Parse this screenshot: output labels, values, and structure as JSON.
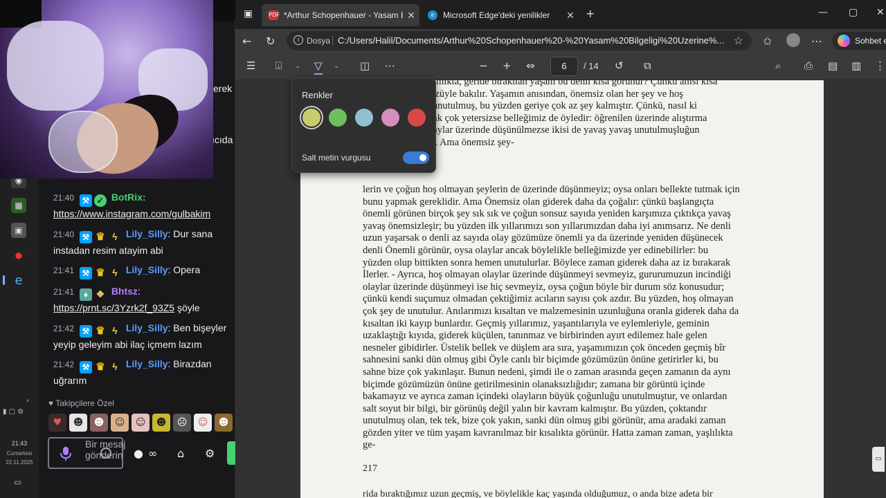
{
  "taskbar": {
    "clock_time": "21:43",
    "clock_day": "Cumartesi",
    "clock_date": "22.11.2025"
  },
  "chat": {
    "partial_text_1": "erek",
    "partial_text_2": "ıcıda",
    "messages": [
      {
        "time": "21:40",
        "user": "BotRix:",
        "text": "https://www.instagram.com/gulbakim",
        "user_color": "#45d26f"
      },
      {
        "time": "21:40",
        "user": "Lily_Silly",
        "text": ": Dur sana instadan resim atayim abi",
        "user_color": "#5b9bff"
      },
      {
        "time": "21:41",
        "user": "Lily_Silly",
        "text": ": Opera",
        "user_color": "#5b9bff"
      },
      {
        "time": "21:41",
        "user": "Bhtsz",
        "text": ":",
        "link": "https://prnt.sc/3Yzrk2f_93Z5",
        "after": " şöyle",
        "user_color": "#b57bff"
      },
      {
        "time": "21:42",
        "user": "Lily_Silly",
        "text": ": Ben bişeyler yeyip geleyim abi ilaç içmem lazım",
        "user_color": "#5b9bff"
      },
      {
        "time": "21:42",
        "user": "Lily_Silly",
        "text": ": Birazdan uğrarım",
        "user_color": "#5b9bff"
      }
    ],
    "follower_label": "Takipçilere Özel",
    "input_placeholder": "Bir mesaj gönderin"
  },
  "browser": {
    "tabs": [
      {
        "title": "*Arthur Schopenhauer - Yasam Bil",
        "active": true,
        "icon": "pdf-icon"
      },
      {
        "title": "Microsoft Edge'deki yenilikler",
        "active": false,
        "icon": "edge-icon"
      }
    ],
    "address": {
      "scheme_label": "Dosya",
      "url": "C:/Users/Halil/Documents/Arthur%20Schopenhauer%20-%20Yasam%20Bilgeligi%20Uzerine%..."
    },
    "copilot_label": "Sohbet e",
    "pdf": {
      "current_page": "6",
      "total_pages": "/ 14",
      "top_lines": [
        "aşımıkta, geride bırakılan yaşam bu denli kısa görünür? Çünkü anısı kısa",
        "gözüyle bakılır. Yaşamın anısından, önemsiz olan her şey ve hoş",
        "u unutulmuş, bu yüzden geriye çok az şey kalmıştır. Çünkü, nasıl ki",
        "arak çok yetersizse belleğimiz de öyledir: öğrenilen üzerinde alıştırma",
        "olaylar üzerinde düşünülmezse ikisi de yavaş yavaş unutulmuşluğun",
        "ler. Ama önemsiz şey-"
      ],
      "body_lines": [
        "lerin ve çoğun hoş olmayan şeylerin de üzerinde düşünmeyiz; oysa onları bellekte tutmak için",
        "bunu yapmak gereklidir. Ama Önemsiz olan giderek daha da çoğalır: çünkü başlangıçta",
        "önemli görünen birçok şey sık sık ve çoğun sonsuz sayıda yeniden karşımıza çıktıkça yavaş",
        "yavaş önemsizleşir; bu yüzden ilk yıllarımızı son yıllarımızdan daha iyi anımsarız. Ne denli",
        "uzun yaşarsak o denli az sayıda olay gözümüze önemli ya da üzerinde yeniden düşünecek",
        "denli Önemli görünür, oysa olaylar ancak böylelikle belleğimizde yer edinebilirler: bu",
        "yüzden olup bittikten sonra hemen unutulurlar. Böylece zaman giderek daha az iz bırakarak",
        "İlerler. - Ayrıca, hoş olmayan olaylar üzerinde düşünmeyi sevmeyiz, gururumuzun incindiği",
        "olaylar üzerinde düşünmeyi ise hiç sevmeyiz, oysa çoğun böyle bir durum söz konusudur;",
        "çünkü kendi suçumuz olmadan çektiğimiz acıların sayısı çok azdır. Bu yüzden, hoş olmayan",
        "çok şey de unutulur. Anılarımızı kısaltan ve malzemesinin uzunluğuna oranla giderek daha da",
        "kısaltan iki kayıp bunlardır. Geçmiş yıllarımız, yaşantılarıyla ve eylemleriyle, geminin",
        "uzaklaştığı kıyıda, giderek küçülen, tanınmaz ve birbirinden ayırt edilemez hale gelen",
        "nesneler gibidirler. Üstelik bellek ve düşlem ara sıra, yaşamımızın çok önceden geçmiş bîr",
        "sahnesini sanki dün olmuş gibi Öyle canlı bir biçimde gözümüzün önüne getirirler ki, bu",
        "sahne bize çok yakınlaşır. Bunun nedeni, şimdi ile o zaman arasında geçen zamanın da aynı",
        "biçimde gözümüzün önüne getirilmesinin olanaksızlığıdır; zamana bir görüntü içinde",
        "bakamayız ve ayrıca zaman içindeki olayların büyük çoğunluğu unutulmuştur, ve onlardan",
        "salt soyut bir bilgi, bir görünüş değil yalın bir kavram kalmıştır. Bu yüzden, çoktandır",
        "unutulmuş olan, tek tek, bize çok yakın, sanki dün olmuş gibi görünür, ama aradaki zaman",
        "gözden yiter ve tüm yaşam kavranılmaz bir kısalıkta görünür. Hatta zaman zaman, yaşlılıkta",
        "ge-"
      ],
      "page_number": "217",
      "bottom_peek": "rida bıraktığımız uzun geçmiş, ve böylelikle kaç yaşında olduğumuz, o anda bize adeta bir"
    },
    "highlight_popup": {
      "title": "Renkler",
      "colors": [
        "#c8cc6e",
        "#6cc15e",
        "#8ec0d0",
        "#d58dbb",
        "#d94848"
      ],
      "toggle_label": "Salt metin vurgusu",
      "toggle_on": true
    }
  }
}
